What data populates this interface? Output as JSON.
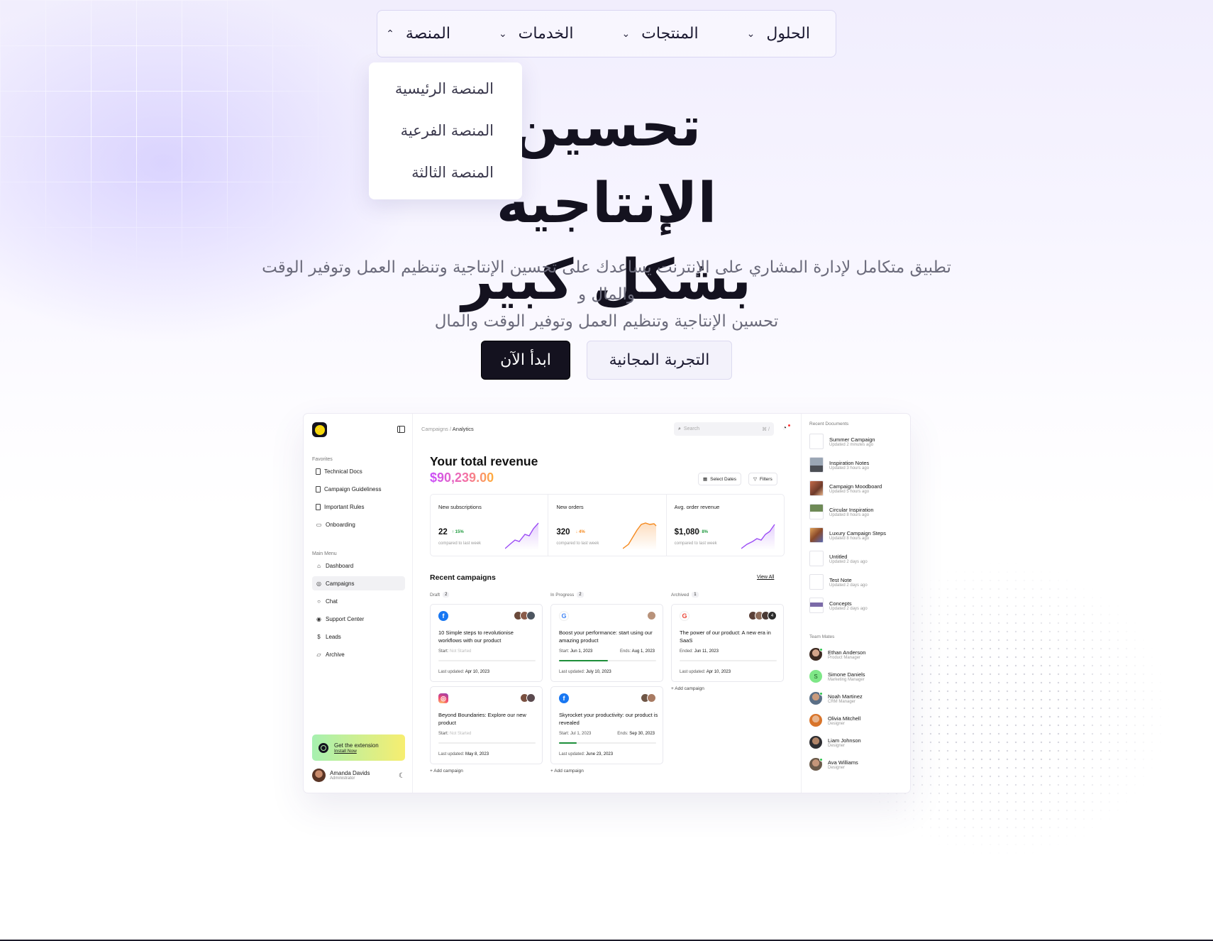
{
  "nav": {
    "items": [
      "الحلول",
      "المنتجات",
      "الخدمات",
      "المنصة"
    ],
    "active": "المنصة",
    "dropdown": [
      "المنصة الرئيسية",
      "المنصة الفرعية",
      "المنصة الثالثة"
    ]
  },
  "hero": {
    "title_line1": "تحسين الإنتاجية",
    "title_line2": "بشكل كبير",
    "subtitle_line1": "تطبيق متكامل لإدارة المشاري على الإنترنت يساعدك على تحسين الإنتاجية وتنظيم العمل وتوفير الوقت والمال و",
    "subtitle_line2": "تحسين الإنتاجية وتنظيم العمل وتوفير الوقت والمال",
    "primary_cta": "ابدأ الآن",
    "secondary_cta": "التجربة المجانية"
  },
  "app": {
    "favorites_label": "Favorites",
    "favorites": [
      "Technical Docs",
      "Campaign Guideliness",
      "Important Rules",
      "Onboarding"
    ],
    "main_menu_label": "Main Menu",
    "main_menu": [
      "Dashboard",
      "Campaigns",
      "Chat",
      "Support Center",
      "Leads",
      "Archive"
    ],
    "active_menu": "Campaigns",
    "extension": {
      "title": "Get the extension",
      "link": "Install Now"
    },
    "user": {
      "name": "Amanda Davids",
      "role": "Administrator"
    },
    "breadcrumb": {
      "parent": "Campaigns",
      "current": "Analytics"
    },
    "search": {
      "placeholder": "Search",
      "shortcut": "⌘ /"
    },
    "revenue": {
      "title": "Your total revenue",
      "value": "$90,239.00"
    },
    "buttons": {
      "dates": "Select Dates",
      "filters": "Filters"
    },
    "stats": [
      {
        "label": "New subscriptions",
        "value": "22",
        "change": "15%",
        "direction": "up",
        "note": "compared to last week",
        "color": "#9b4cf5"
      },
      {
        "label": "New orders",
        "value": "320",
        "change": "4%",
        "direction": "down",
        "note": "compared to last week",
        "color": "#f58a1f"
      },
      {
        "label": "Avg. order revenue",
        "value": "$1,080",
        "change": "8%",
        "direction": "up",
        "note": "compared to last week",
        "color": "#9b4cf5"
      }
    ],
    "recent": {
      "title": "Recent campaigns",
      "view_all": "View All",
      "add": "Add campaign",
      "columns": [
        {
          "name": "Draft",
          "count": "2"
        },
        {
          "name": "In Progress",
          "count": "2"
        },
        {
          "name": "Archived",
          "count": "1"
        }
      ],
      "cards": [
        {
          "title": "10 Simple steps to revolutionise workflows with our product",
          "start_label": "Start:",
          "start": "Not Started",
          "end_label": "",
          "end": "",
          "progress": 0,
          "updated_label": "Last updated:",
          "updated": "Apr 10, 2023",
          "network": "facebook"
        },
        {
          "title": "Beyond Boundaries: Explore our new product",
          "start_label": "Start:",
          "start": "Not Started",
          "end_label": "",
          "end": "",
          "progress": 0,
          "updated_label": "Last updated:",
          "updated": "May 8, 2023",
          "network": "instagram"
        },
        {
          "title": "Boost your performance: start using our amazing product",
          "start_label": "Start:",
          "start": "Jun 1, 2023",
          "end_label": "Ends:",
          "end": "Aug 1, 2023",
          "progress": 0.5,
          "updated_label": "Last updated:",
          "updated": "July 10, 2023",
          "network": "google"
        },
        {
          "title": "Skyrocket your productivity: our product is revealed",
          "start_label": "Start:",
          "start": "Jul 1, 2023",
          "end_label": "Ends:",
          "end": "Sep 30, 2023",
          "progress": 0.18,
          "updated_label": "Last updated:",
          "updated": "June 23, 2023",
          "network": "facebook"
        },
        {
          "title": "The power of our product: A new era in SaaS",
          "start_label": "Ended:",
          "start": "Jun 11, 2023",
          "end_label": "",
          "end": "",
          "progress": 0,
          "updated_label": "Last updated:",
          "updated": "Apr 10, 2023",
          "network": "google",
          "extra_avatars": "4"
        }
      ]
    },
    "recent_docs_label": "Recent Documents",
    "docs": [
      {
        "name": "Summer Campaign",
        "time": "Updated 2 minutes ago"
      },
      {
        "name": "Inspiration Notes",
        "time": "Updated 3 hours ago"
      },
      {
        "name": "Campaign Moodboard",
        "time": "Updated 5 hours ago"
      },
      {
        "name": "Circular Inspiration",
        "time": "Updated 8 hours ago"
      },
      {
        "name": "Luxury Campaign Steps",
        "time": "Updated 8 hours ago"
      },
      {
        "name": "Untitled",
        "time": "Updated 2 days ago"
      },
      {
        "name": "Test Note",
        "time": "Updated 2 days ago"
      },
      {
        "name": "Concepts",
        "time": "Updated 2 days ago"
      }
    ],
    "team_label": "Team Mates",
    "team": [
      {
        "name": "Ethan Anderson",
        "role": "Product Manager",
        "initial": ""
      },
      {
        "name": "Simone Daniels",
        "role": "Marketing Manager",
        "initial": "S"
      },
      {
        "name": "Noah Martinez",
        "role": "CRM Manager",
        "initial": ""
      },
      {
        "name": "Olivia Mitchell",
        "role": "Designer",
        "initial": ""
      },
      {
        "name": "Liam Johnson",
        "role": "Designer",
        "initial": ""
      },
      {
        "name": "Ava Williams",
        "role": "Designer",
        "initial": ""
      }
    ]
  }
}
